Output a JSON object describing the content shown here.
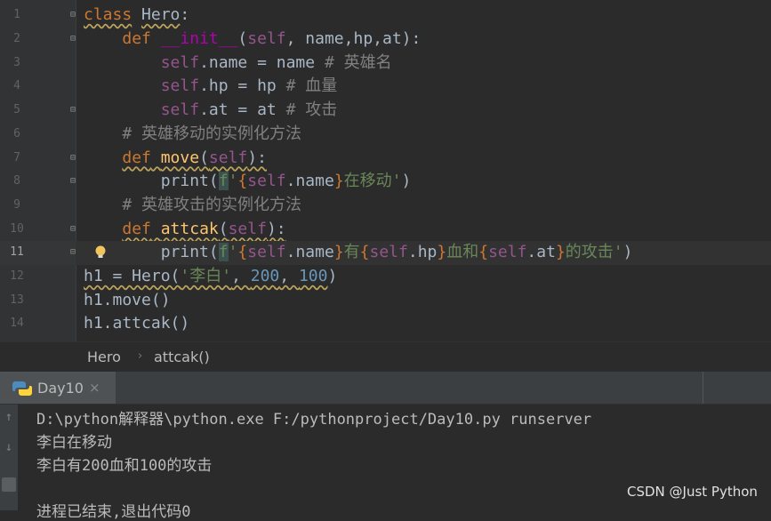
{
  "editor": {
    "line_numbers": [
      "1",
      "2",
      "3",
      "4",
      "5",
      "6",
      "7",
      "8",
      "9",
      "10",
      "11",
      "12",
      "13",
      "14"
    ],
    "lines": [
      {
        "kw": "class",
        "name": "Hero",
        "colon": ":"
      },
      {
        "def": "def",
        "fn": "__init__",
        "open": "(",
        "self": "self",
        "rest": ", name,hp,at):"
      },
      {
        "self": "self",
        ".name": ".name = name",
        "com": "# 英雄名"
      },
      {
        "self": "self",
        ".hp": ".hp = hp",
        "com": "# 血量"
      },
      {
        "self": "self",
        ".at": ".at = at",
        "com": "# 攻击"
      },
      {
        "com": "# 英雄移动的实例化方法"
      },
      {
        "def": "def",
        "fn": "move",
        "open": "(",
        "self": "self",
        "close": "):"
      },
      {
        "print": "print(",
        "f": "f",
        "q1": "'",
        "b1": "{",
        "self": "self",
        "attr": ".name",
        "b2": "}",
        "txt": "在移动'",
        "close": ")"
      },
      {
        "com": "# 英雄攻击的实例化方法"
      },
      {
        "def": "def",
        "fn": "attcak",
        "open": "(",
        "self": "self",
        "close": "):"
      },
      {
        "print": "print(",
        "f": "f",
        "q1": "'",
        "self1": "self",
        "attr1": ".name",
        "t1": "有",
        "self2": "self",
        "attr2": ".hp",
        "t2": "血和",
        "self3": "self",
        "attr3": ".at",
        "t3": "的攻击'",
        "close": ")"
      },
      {
        "lhs": "h1 = Hero(",
        "s": "'李白'",
        "c1": ", ",
        "n1": "200",
        "c2": ", ",
        "n2": "100",
        "close": ")"
      },
      {
        "code": "h1.move()"
      },
      {
        "code": "h1.attcak()"
      }
    ]
  },
  "breadcrumb": {
    "class": "Hero",
    "method": "attcak()"
  },
  "run_tab": {
    "label": "Day10",
    "close": "×"
  },
  "console": {
    "lines": [
      "D:\\python解释器\\python.exe F:/pythonproject/Day10.py runserver",
      "李白在移动",
      "李白有200血和100的攻击",
      "",
      "进程已结束,退出代码0"
    ]
  },
  "watermark": "CSDN @Just Python",
  "colors": {
    "background": "#2b2b2b",
    "keyword": "#cc7832",
    "self": "#94558d",
    "function": "#ffc66d",
    "string": "#6a8759",
    "number": "#6897bb",
    "comment": "#808080"
  }
}
